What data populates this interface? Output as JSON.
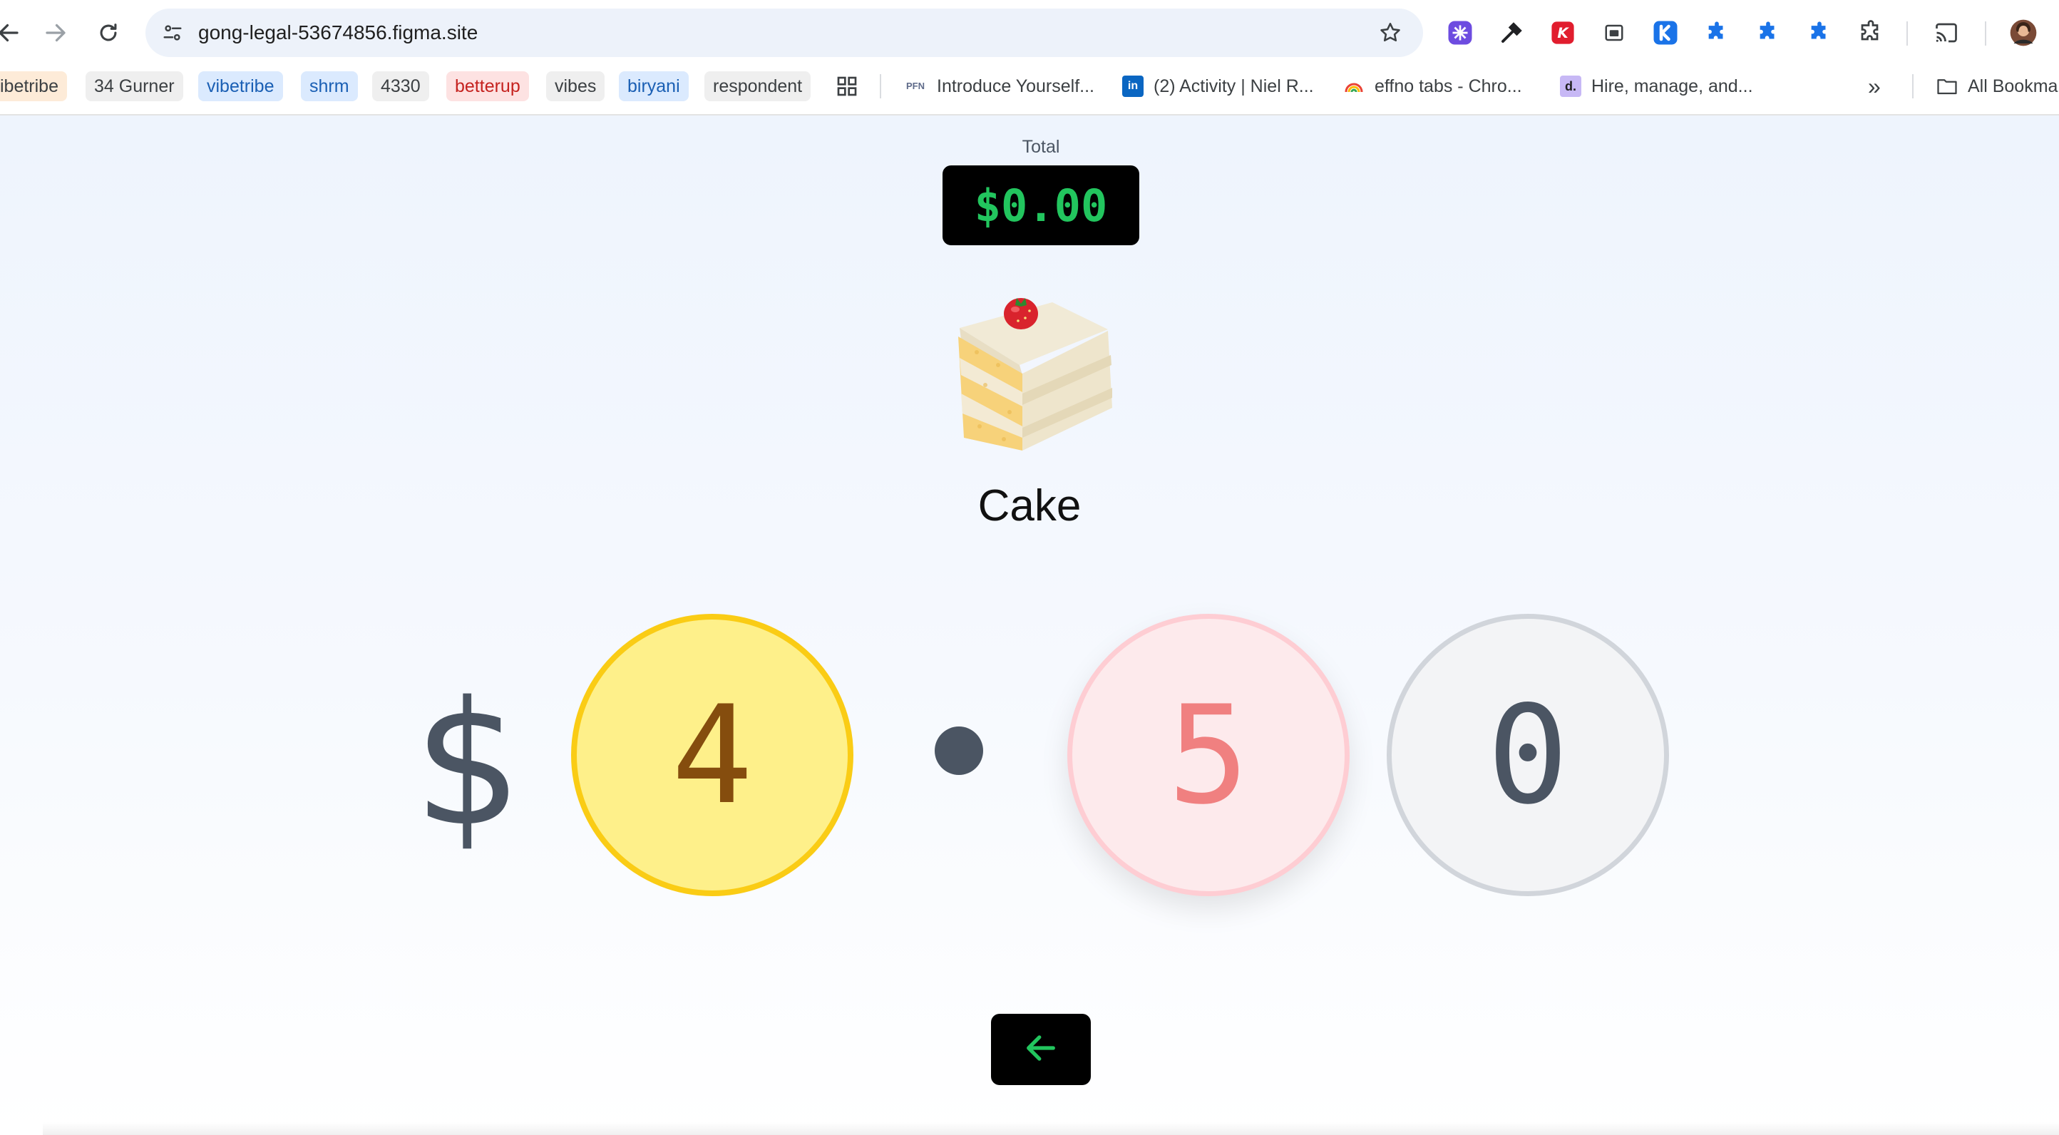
{
  "browser": {
    "url": "gong-legal-53674856.figma.site",
    "icons": [
      "back-arrow-icon",
      "forward-arrow-icon",
      "reload-icon",
      "site-info-icon",
      "bookmark-star-icon",
      "cast-icon",
      "profile-avatar"
    ],
    "extensions": [
      "perplexity-icon",
      "eyedropper-icon",
      "k-extension-icon",
      "tab-capture-icon",
      "k-blue-extension-icon",
      "puzzle-icon",
      "puzzle-icon",
      "puzzle-icon",
      "extensions-menu-icon"
    ]
  },
  "bookmarks": {
    "chips": [
      {
        "label": "ibetribe",
        "bg": "#fdebd8",
        "fg": "#3c4043"
      },
      {
        "label": "34 Gurner",
        "bg": "#efefef",
        "fg": "#3c4043"
      },
      {
        "label": "vibetribe",
        "bg": "#dbeafe",
        "fg": "#1a5fb4"
      },
      {
        "label": "shrm",
        "bg": "#dbeafe",
        "fg": "#1a5fb4"
      },
      {
        "label": "4330",
        "bg": "#efefef",
        "fg": "#3c4043"
      },
      {
        "label": "betterup",
        "bg": "#fde2e2",
        "fg": "#c5221f"
      },
      {
        "label": "vibes",
        "bg": "#efefef",
        "fg": "#3c4043"
      },
      {
        "label": "biryani",
        "bg": "#dbeafe",
        "fg": "#1a5fb4"
      },
      {
        "label": "respondent",
        "bg": "#efefef",
        "fg": "#3c4043"
      }
    ],
    "links": [
      {
        "label": "Introduce Yourself...",
        "icon": "pfn-icon"
      },
      {
        "label": "(2) Activity | Niel R...",
        "icon": "linkedin-icon"
      },
      {
        "label": "effno tabs - Chro...",
        "icon": "rainbow-icon"
      },
      {
        "label": "Hire, manage, and...",
        "icon": "deel-icon"
      }
    ],
    "more": "»",
    "all_bookmarks": "All Bookmarks"
  },
  "app": {
    "total_label": "Total",
    "total_value": "$0.00",
    "item_name": "Cake",
    "item_icon": "cake-icon",
    "currency_symbol": "$",
    "digits": [
      "4",
      "5",
      "0"
    ],
    "back_icon": "arrow-left-icon",
    "colors": {
      "display_bg": "#000000",
      "display_text": "#22c55e",
      "digit1_fill": "#fef08a",
      "digit1_ring": "#facc15",
      "digit2_fill": "#fdeaec",
      "digit2_ring": "#fecdd3",
      "digit3_fill": "#f3f4f6",
      "digit3_ring": "#d1d5db"
    }
  }
}
